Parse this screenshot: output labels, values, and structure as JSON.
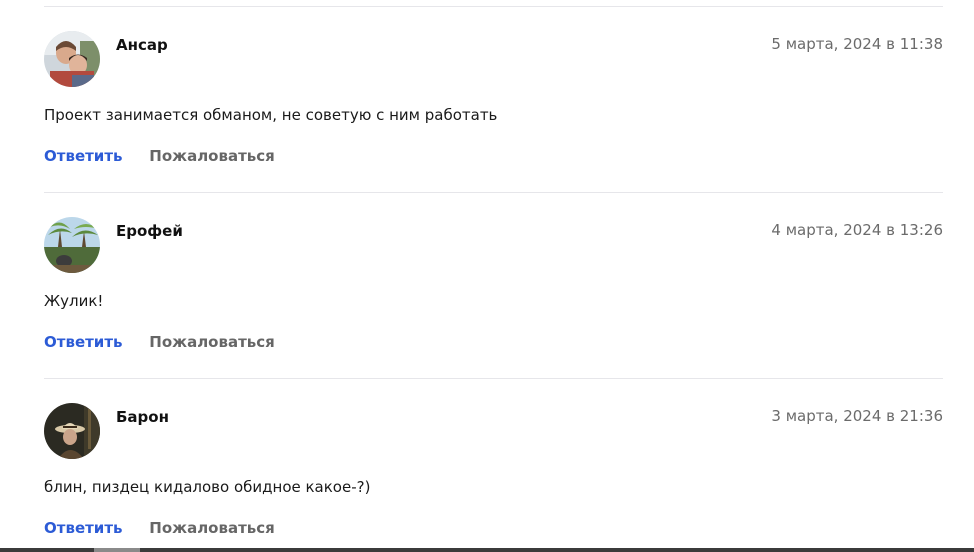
{
  "comments": [
    {
      "author": "Ансар",
      "date": "5 марта, 2024 в 11:38",
      "text": "Проект занимается обманом, не советую с ним работать",
      "reply_label": "Ответить",
      "report_label": "Пожаловаться",
      "avatar_icon": "user-photo-icon"
    },
    {
      "author": "Ерофей",
      "date": "4 марта, 2024 в 13:26",
      "text": "Жулик!",
      "reply_label": "Ответить",
      "report_label": "Пожаловаться",
      "avatar_icon": "user-photo-icon"
    },
    {
      "author": "Барон",
      "date": "3 марта, 2024 в 21:36",
      "text": "блин, пиздец кидалово обидное какое-?)",
      "reply_label": "Ответить",
      "report_label": "Пожаловаться",
      "avatar_icon": "user-photo-icon"
    }
  ],
  "colors": {
    "accent_link": "#2c5bd6",
    "muted_text": "#6b6b6b",
    "divider": "#e6e6ea"
  }
}
